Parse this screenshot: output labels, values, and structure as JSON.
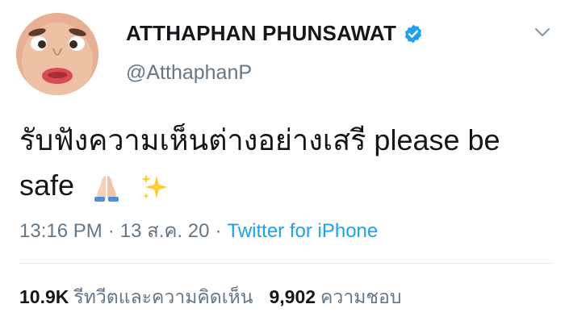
{
  "user": {
    "display_name": "ATTHAPHAN PHUNSAWAT",
    "handle": "@AtthaphanP",
    "verified": true
  },
  "tweet": {
    "text": "รับฟังความเห็นต่างอย่างเสรี please be safe",
    "emojis": [
      "folded-hands-icon",
      "sparkles-icon"
    ]
  },
  "meta": {
    "time": "13:16 PM",
    "separator": "·",
    "date": "13 ส.ค. 20",
    "source": "Twitter for iPhone"
  },
  "stats": {
    "retweets_count": "10.9K",
    "retweets_label": "รีทวีตและความคิดเห็น",
    "likes_count": "9,902",
    "likes_label": "ความชอบ"
  },
  "colors": {
    "accent": "#1da1f2",
    "muted": "#657786",
    "text": "#14171a"
  }
}
